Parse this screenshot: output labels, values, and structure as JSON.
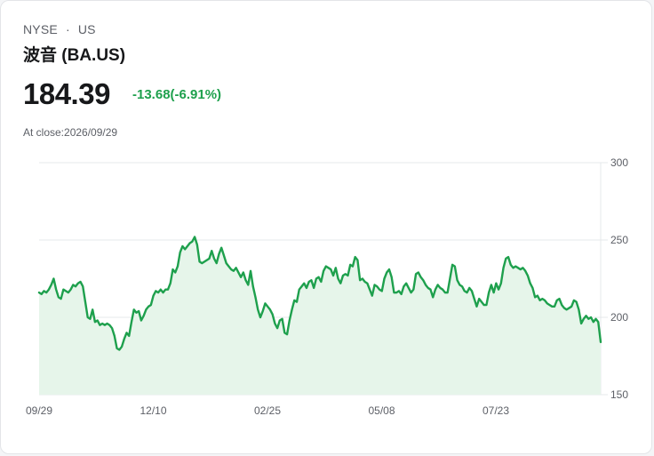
{
  "header": {
    "exchange": "NYSE",
    "separator": "·",
    "market": "US",
    "stock_name": "波音 (BA.US)",
    "price": "184.39",
    "change": "-13.68(-6.91%)",
    "close_label": "At close:2026/09/29"
  },
  "colors": {
    "line": "#1ea04d",
    "fill": "#e6f5ea",
    "change": "#1ea04d",
    "grid": "#e6e8eb"
  },
  "chart_data": {
    "type": "area",
    "title": "",
    "xlabel": "",
    "ylabel": "",
    "ylim": [
      150,
      300
    ],
    "y_ticks": [
      "300",
      "250",
      "200",
      "150"
    ],
    "y_tick_values": [
      300,
      250,
      200,
      150
    ],
    "x_ticks": [
      "09/29",
      "12/10",
      "02/25",
      "05/08",
      "07/23"
    ],
    "grid": true,
    "legend": "none",
    "series": [
      {
        "values": [
          216,
          215,
          217,
          216,
          218,
          221,
          225,
          218,
          213,
          212,
          218,
          217,
          216,
          218,
          221,
          220,
          222,
          223,
          220,
          210,
          200,
          199,
          205,
          197,
          198,
          195,
          196,
          195,
          196,
          195,
          193,
          188,
          180,
          179,
          181,
          186,
          190,
          188,
          197,
          205,
          203,
          204,
          198,
          201,
          205,
          207,
          208,
          214,
          217,
          216,
          218,
          216,
          218,
          218,
          222,
          231,
          229,
          233,
          242,
          246,
          244,
          246,
          248,
          249,
          252,
          247,
          236,
          235,
          236,
          237,
          238,
          243,
          238,
          235,
          241,
          245,
          240,
          235,
          233,
          231,
          230,
          232,
          229,
          226,
          229,
          224,
          221,
          230,
          220,
          213,
          205,
          200,
          204,
          209,
          207,
          205,
          202,
          196,
          193,
          198,
          199,
          190,
          189,
          198,
          205,
          211,
          210,
          218,
          220,
          222,
          219,
          223,
          224,
          219,
          225,
          226,
          223,
          230,
          233,
          232,
          231,
          227,
          232,
          225,
          222,
          227,
          228,
          227,
          234,
          233,
          239,
          237,
          224,
          225,
          223,
          222,
          218,
          214,
          221,
          220,
          218,
          217,
          225,
          229,
          231,
          226,
          216,
          216,
          217,
          215,
          220,
          222,
          219,
          216,
          218,
          228,
          229,
          226,
          224,
          221,
          219,
          218,
          213,
          218,
          221,
          219,
          218,
          216,
          216,
          225,
          234,
          233,
          224,
          221,
          220,
          217,
          216,
          219,
          217,
          212,
          207,
          212,
          210,
          208,
          208,
          216,
          221,
          216,
          222,
          218,
          222,
          232,
          238,
          239,
          234,
          232,
          233,
          232,
          231,
          232,
          230,
          227,
          222,
          219,
          213,
          214,
          211,
          212,
          211,
          209,
          208,
          207,
          207,
          211,
          212,
          208,
          206,
          205,
          206,
          207,
          211,
          210,
          205,
          196,
          199,
          201,
          199,
          200,
          197,
          199,
          197,
          184
        ]
      }
    ]
  }
}
